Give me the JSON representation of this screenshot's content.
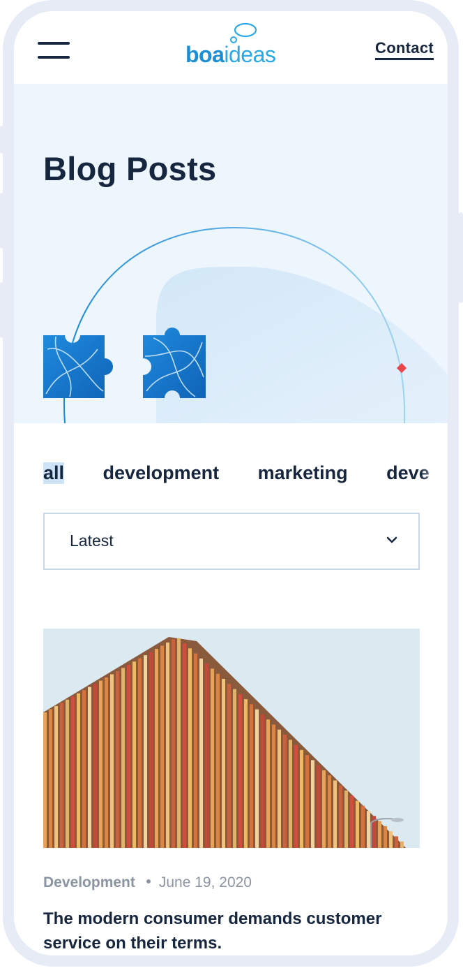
{
  "brand": {
    "logo_part1": "boa",
    "logo_part2": "ideas"
  },
  "header": {
    "contact_label": "Contact"
  },
  "hero": {
    "title": "Blog Posts"
  },
  "filters": {
    "items": [
      "all",
      "development",
      "marketing",
      "deve"
    ],
    "active": "all"
  },
  "sort": {
    "selected": "Latest"
  },
  "post": {
    "category": "Development",
    "date": "June 19, 2020",
    "title": "The modern consumer demands customer service on their terms."
  },
  "colors": {
    "navy": "#16263f",
    "brand_blue": "#1b8fd6",
    "hero_bg": "#edf5fd",
    "accent_red": "#e9464b"
  }
}
